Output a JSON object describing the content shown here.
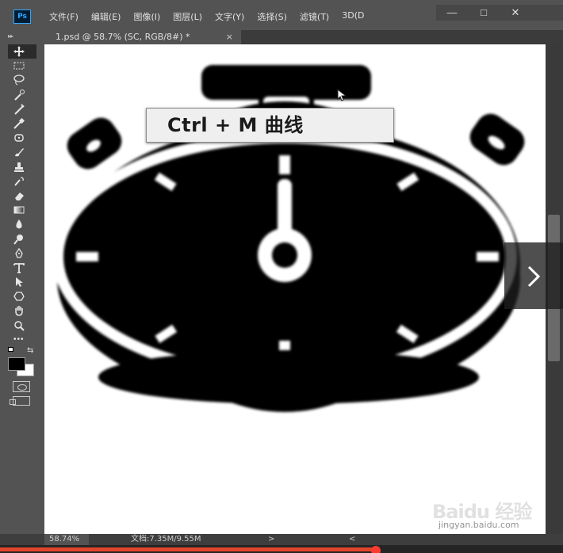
{
  "app": {
    "logo": "Ps"
  },
  "menu": [
    "文件(F)",
    "编辑(E)",
    "图像(I)",
    "图层(L)",
    "文字(Y)",
    "选择(S)",
    "滤镜(T)",
    "3D(D"
  ],
  "window_buttons": {
    "minimize": "—",
    "restore": "□",
    "close": "✕"
  },
  "document_tab": {
    "title": "1.psd @ 58.7% (SC, RGB/8#) *",
    "close": "×"
  },
  "toolbar": {
    "collapse": "▸▸"
  },
  "overlay": {
    "shortcut_label": "Ctrl + M  曲线"
  },
  "statusbar": {
    "zoom": "58.74%",
    "doc_info": "文档:7.35M/9.55M",
    "arrow_right": ">",
    "arrow_left": "<"
  },
  "video": {
    "progress": 0.668
  },
  "watermark": {
    "logo": "Baidu 经验",
    "sub": "jingyan.baidu.com"
  },
  "colors": {
    "accent": "#e2452c",
    "ps_blue": "#31a8ff",
    "panel": "#535353"
  }
}
